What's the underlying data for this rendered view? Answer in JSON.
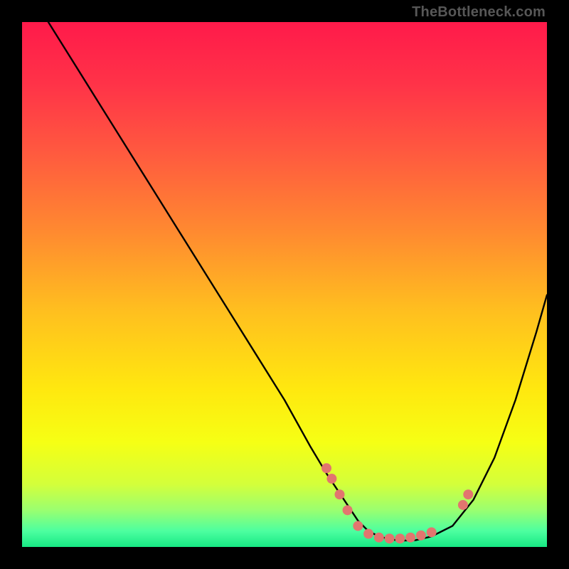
{
  "attribution": "TheBottleneck.com",
  "colors": {
    "frame": "#000000",
    "gradient_stops": [
      {
        "offset": 0.0,
        "color": "#ff1a4a"
      },
      {
        "offset": 0.12,
        "color": "#ff3348"
      },
      {
        "offset": 0.25,
        "color": "#ff5a3f"
      },
      {
        "offset": 0.4,
        "color": "#ff8a30"
      },
      {
        "offset": 0.55,
        "color": "#ffbf1f"
      },
      {
        "offset": 0.7,
        "color": "#ffe80f"
      },
      {
        "offset": 0.8,
        "color": "#f6ff14"
      },
      {
        "offset": 0.88,
        "color": "#d4ff3a"
      },
      {
        "offset": 0.93,
        "color": "#9aff70"
      },
      {
        "offset": 0.97,
        "color": "#4cffa0"
      },
      {
        "offset": 1.0,
        "color": "#17e884"
      }
    ],
    "curve": "#000000",
    "marker": "#e2756f"
  },
  "chart_data": {
    "type": "line",
    "title": "",
    "xlabel": "",
    "ylabel": "",
    "xlim": [
      0,
      100
    ],
    "ylim": [
      0,
      100
    ],
    "series": [
      {
        "name": "bottleneck-curve",
        "x": [
          5,
          10,
          15,
          20,
          25,
          30,
          35,
          40,
          45,
          50,
          55,
          58,
          60,
          62,
          64,
          66,
          68,
          70,
          72,
          75,
          78,
          82,
          86,
          90,
          94,
          98,
          100
        ],
        "y": [
          100,
          92,
          84,
          76,
          68,
          60,
          52,
          44,
          36,
          28,
          19,
          14,
          11,
          8,
          5,
          3,
          2,
          1.5,
          1.2,
          1.3,
          2,
          4,
          9,
          17,
          28,
          41,
          48
        ]
      }
    ],
    "markers": {
      "name": "highlight-points",
      "x": [
        58,
        59,
        60.5,
        62,
        64,
        66,
        68,
        70,
        72,
        74,
        76,
        78,
        84,
        85
      ],
      "y": [
        15,
        13,
        10,
        7,
        4,
        2.5,
        1.8,
        1.6,
        1.6,
        1.8,
        2.2,
        2.8,
        8,
        10
      ]
    }
  }
}
